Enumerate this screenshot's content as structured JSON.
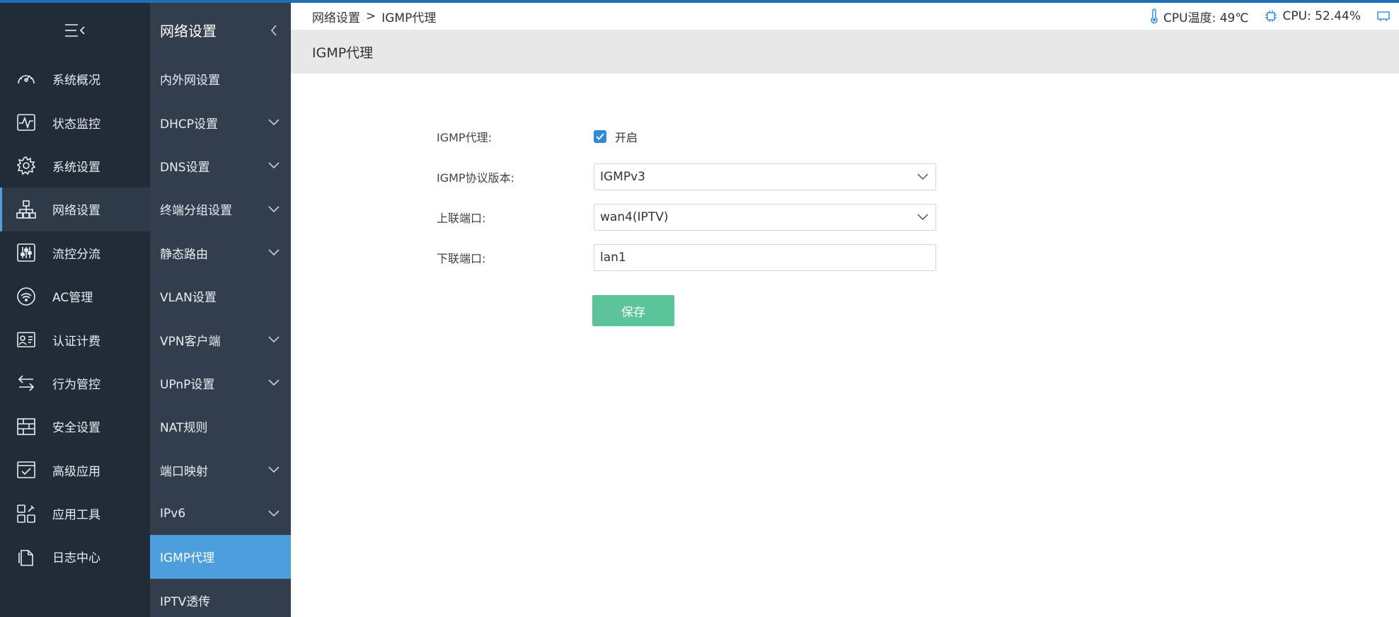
{
  "sidebar": {
    "items": [
      {
        "label": "系统概况",
        "icon": "dashboard-gauge-icon"
      },
      {
        "label": "状态监控",
        "icon": "activity-monitor-icon"
      },
      {
        "label": "系统设置",
        "icon": "gear-icon"
      },
      {
        "label": "网络设置",
        "icon": "network-topology-icon",
        "active": true
      },
      {
        "label": "流控分流",
        "icon": "sliders-icon"
      },
      {
        "label": "AC管理",
        "icon": "wifi-router-icon"
      },
      {
        "label": "认证计费",
        "icon": "id-card-icon"
      },
      {
        "label": "行为管控",
        "icon": "swap-arrows-icon"
      },
      {
        "label": "安全设置",
        "icon": "firewall-icon"
      },
      {
        "label": "高级应用",
        "icon": "checked-window-icon"
      },
      {
        "label": "应用工具",
        "icon": "tools-grid-icon"
      },
      {
        "label": "日志中心",
        "icon": "document-copy-icon"
      }
    ]
  },
  "submenu": {
    "title": "网络设置",
    "items": [
      {
        "label": "内外网设置"
      },
      {
        "label": "DHCP设置"
      },
      {
        "label": "DNS设置"
      },
      {
        "label": "终端分组设置"
      },
      {
        "label": "静态路由"
      },
      {
        "label": "VLAN设置"
      },
      {
        "label": "VPN客户端"
      },
      {
        "label": "UPnP设置"
      },
      {
        "label": "NAT规则"
      },
      {
        "label": "端口映射"
      },
      {
        "label": "IPv6"
      },
      {
        "label": "IGMP代理"
      },
      {
        "label": "IPTV透传"
      }
    ]
  },
  "topbar": {
    "breadcrumb_parent": "网络设置",
    "breadcrumb_sep": ">",
    "breadcrumb_current": "IGMP代理",
    "cpu_temp": "CPU温度: 49℃",
    "cpu_usage": "CPU: 52.44%"
  },
  "page": {
    "title": "IGMP代理"
  },
  "form": {
    "igmp_proxy_label": "IGMP代理:",
    "igmp_proxy_checkbox_label": "开启",
    "igmp_version_label": "IGMP协议版本:",
    "igmp_version_value": "IGMPv3",
    "uplink_label": "上联端口:",
    "uplink_value": "wan4(IPTV)",
    "downlink_label": "下联端口:",
    "downlink_value": "lan1",
    "save_label": "保存"
  },
  "colors": {
    "rail_bg": "#222c38",
    "submenu_bg": "#323e4d",
    "active_blue": "#4d9edc",
    "save_green": "#5cc49a",
    "top_accent": "#1e6fb6"
  }
}
